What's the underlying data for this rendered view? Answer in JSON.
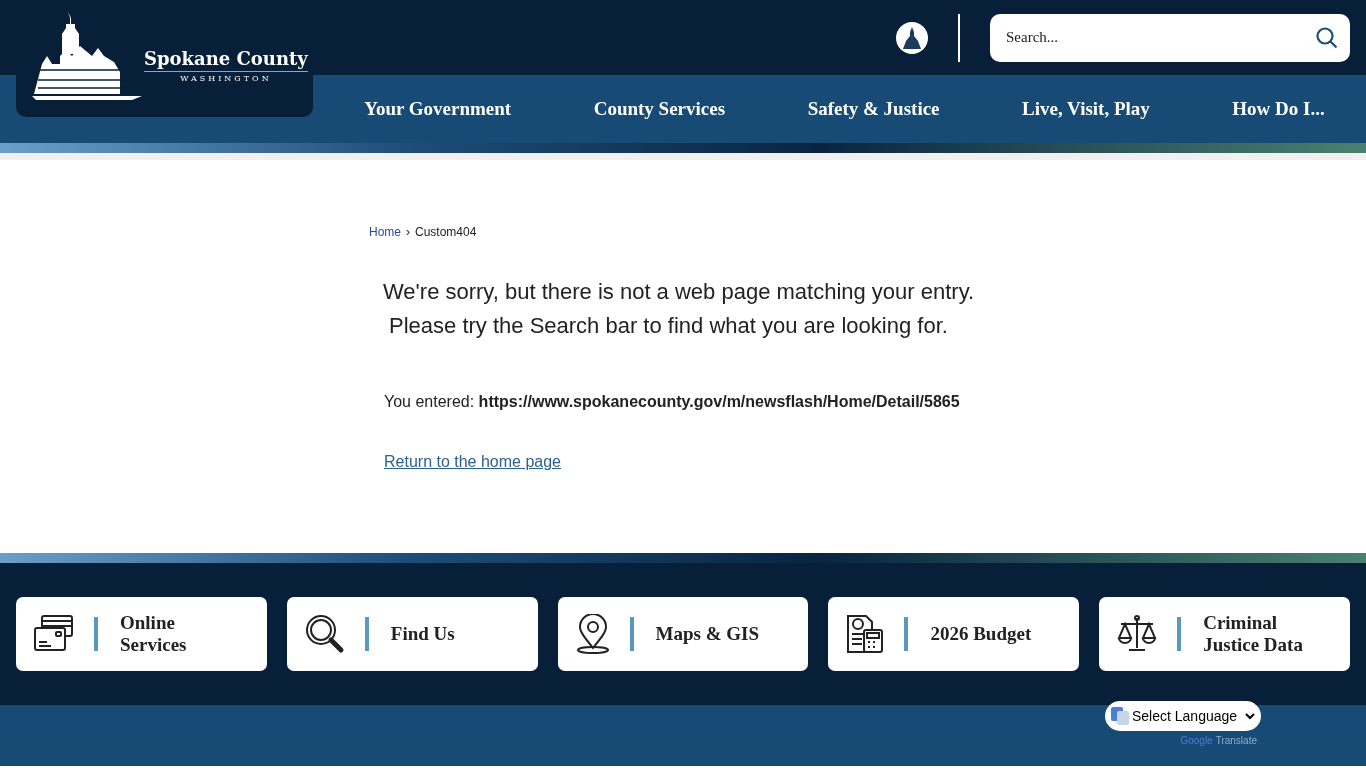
{
  "header": {
    "logo": {
      "title": "Spokane County",
      "subtitle": "WASHINGTON"
    },
    "search": {
      "placeholder": "Search..."
    }
  },
  "nav": [
    "Your Government",
    "County Services",
    "Safety & Justice",
    "Live, Visit, Play",
    "How Do I..."
  ],
  "breadcrumb": {
    "separator": "›",
    "items": [
      {
        "label": "Home",
        "link": true
      },
      {
        "label": "Custom404",
        "link": false
      }
    ]
  },
  "message": [
    "We're sorry, but there is not a web page matching your entry.",
    "Please try the Search bar to find what you are looking for."
  ],
  "entered": {
    "label": "You entered:",
    "url": "https://www.spokanecounty.gov/m/newsflash/Home/Detail/5865"
  },
  "return_link": "Return to the home page",
  "quick_links": [
    {
      "kind": "cards",
      "label": "Online Services"
    },
    {
      "kind": "search",
      "label": "Find Us"
    },
    {
      "kind": "pin",
      "label": "Maps & GIS"
    },
    {
      "kind": "budget",
      "label": "2026 Budget"
    },
    {
      "kind": "scales",
      "label": "Criminal Justice Data"
    }
  ],
  "translate": {
    "select": "Select Language",
    "brand": "Google",
    "product": "Translate"
  }
}
